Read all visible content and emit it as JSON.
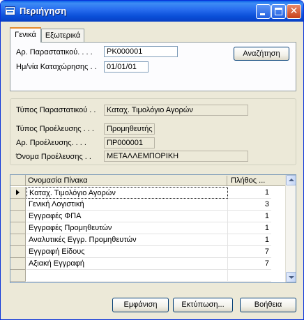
{
  "window": {
    "title": "Περιήγηση",
    "minimize_label": "_",
    "close_label": "✕"
  },
  "tabs": [
    {
      "label": "Γενικά",
      "active": true
    },
    {
      "label": "Εξωτερικά",
      "active": false
    }
  ],
  "general": {
    "doc_no_label": "Αρ. Παραστατικού. . . .",
    "doc_no_value": "PK000001",
    "posting_date_label": "Ημ/νία Καταχώρησης . .",
    "posting_date_value": "01/01/01",
    "find_button": "Αναζήτηση"
  },
  "info": {
    "doc_type_label": "Τύπος Παραστατικού . .",
    "doc_type_value": "Καταχ. Τιμολόγιο Αγορών",
    "source_type_label": "Τύπος Προέλευσης . . .",
    "source_type_value": "Προμηθευτής",
    "source_no_label": "Αρ. Προέλευσης. . . .",
    "source_no_value": "ΠΡ000001",
    "source_name_label": "Όνομα Προέλευσης . .",
    "source_name_value": "ΜΕΤΑΛΛΕΜΠΟΡΙΚΗ"
  },
  "grid": {
    "columns": [
      "Ονομασία Πίνακα",
      "Πλήθος ..."
    ],
    "rows": [
      {
        "name": "Καταχ. Τιμολόγιο Αγορών",
        "count": "1"
      },
      {
        "name": "Γενική Λογιστική",
        "count": "3"
      },
      {
        "name": "Εγγραφές ΦΠΑ",
        "count": "1"
      },
      {
        "name": "Εγγραφές Προμηθευτών",
        "count": "1"
      },
      {
        "name": "Αναλυτικές Εγγρ. Προμηθευτών",
        "count": "1"
      },
      {
        "name": "Εγγραφή Είδους",
        "count": "7"
      },
      {
        "name": "Αξιακή Εγγραφή",
        "count": "7"
      }
    ]
  },
  "buttons": {
    "show": "Εμφάνιση",
    "print": "Εκτύπωση...",
    "help": "Βοήθεια"
  }
}
